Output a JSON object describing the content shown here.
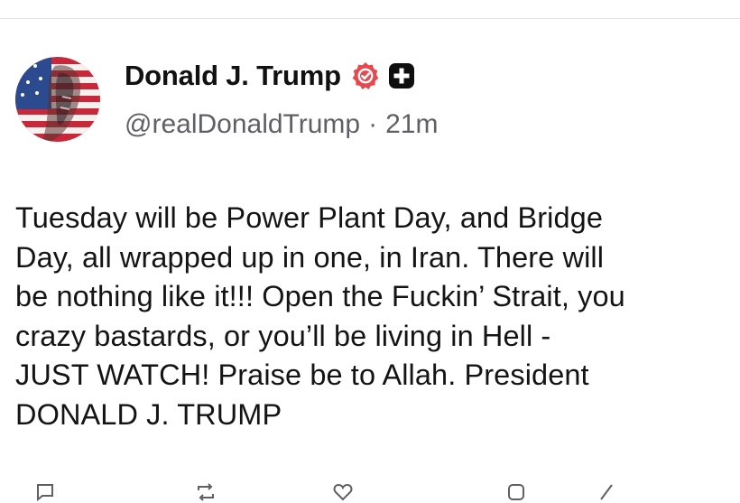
{
  "post": {
    "display_name": "Donald J. Trump",
    "handle": "@realDonaldTrump",
    "separator": "·",
    "time_ago": "21m",
    "body": "Tuesday will be Power Plant Day, and Bridge\nDay, all wrapped up in one, in Iran. There will\nbe nothing like it!!! Open the Fuckin’ Strait, you\ncrazy bastards, or you’ll be living in Hell -\nJUST WATCH! Praise be to Allah. President\nDONALD J. TRUMP",
    "avatar_icon": "flag-portrait-avatar",
    "badges": [
      "verified-badge-icon",
      "plus-badge-icon"
    ]
  },
  "colors": {
    "text_primary": "#111111",
    "text_secondary": "#5f5f66",
    "verified_badge": "#e5484d",
    "plus_badge": "#0f0f0f",
    "divider": "#e6e6ea"
  },
  "actions": [
    "reply-icon",
    "repost-icon",
    "like-icon",
    "share-icon",
    "more-icon"
  ]
}
